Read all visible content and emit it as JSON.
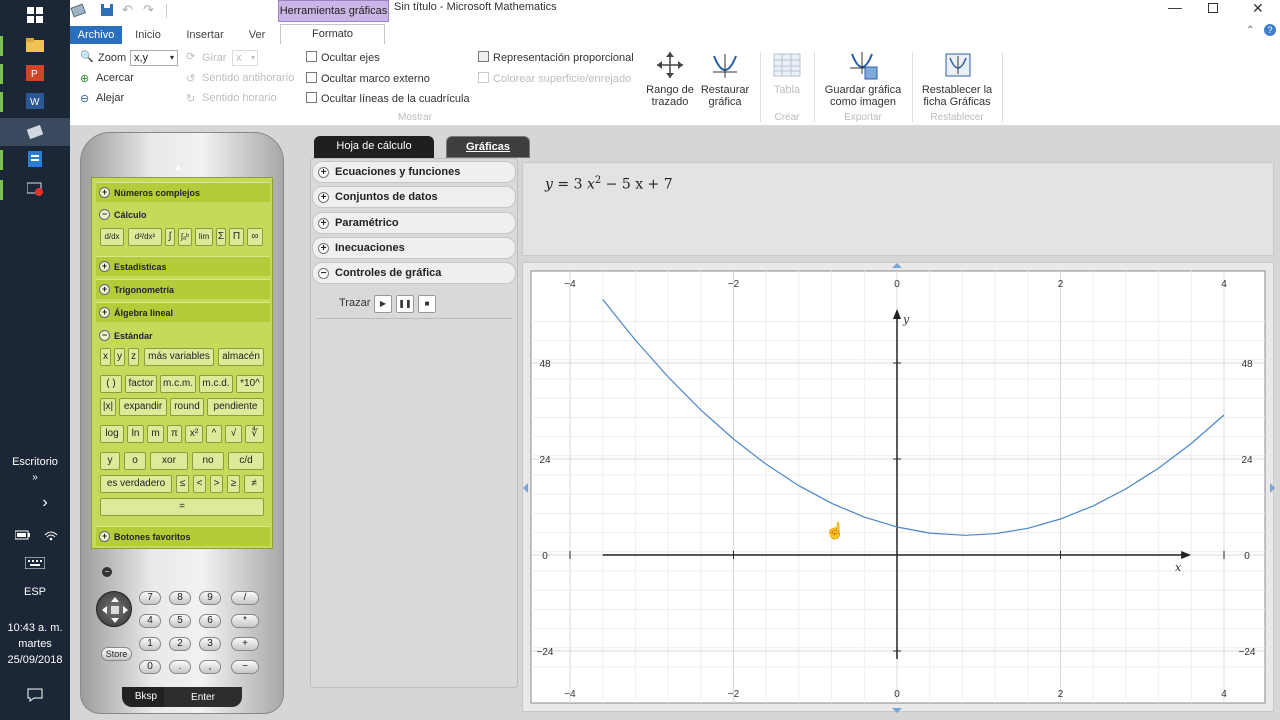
{
  "taskbar": {
    "desktop_label": "Escritorio",
    "language": "ESP",
    "time": "10:43 a. m.",
    "weekday": "martes",
    "date": "25/09/2018"
  },
  "titlebar": {
    "context_tab": "Herramientas gráficas",
    "title": "Sin título - Microsoft Mathematics"
  },
  "ribbon": {
    "tabs": [
      "Archivo",
      "Inicio",
      "Insertar",
      "Ver",
      "Formato"
    ],
    "zoom_label": "Zoom",
    "zoom_value": "x,y",
    "girar_label": "Girar",
    "girar_value": "x",
    "acercar": "Acercar",
    "alejar": "Alejar",
    "sentido_antihorario": "Sentido antihorario",
    "sentido_horario": "Sentido horario",
    "ocultar_ejes": "Ocultar ejes",
    "ocultar_marco": "Ocultar marco externo",
    "ocultar_lineas": "Ocultar líneas de la cuadrícula",
    "representacion": "Representación proporcional",
    "colorear": "Colorear superficie/enrejado",
    "group_mostrar": "Mostrar",
    "rango_line1": "Rango de",
    "rango_line2": "trazado",
    "restaurar_line1": "Restaurar",
    "restaurar_line2": "gráfica",
    "tabla": "Tabla",
    "group_crear": "Crear",
    "guardar_line1": "Guardar gráfica",
    "guardar_line2": "como imagen",
    "group_exportar": "Exportar",
    "restablecer_line1": "Restablecer la",
    "restablecer_line2": "ficha Gráficas",
    "group_restablecer": "Restablecer"
  },
  "calculator": {
    "sections": {
      "complejos": "Números complejos",
      "calculo": "Cálculo",
      "estadisticas": "Estadísticas",
      "trigonometria": "Trigonometría",
      "algebra": "Álgebra lineal",
      "estandar": "Estándar",
      "favoritos": "Botones favoritos"
    },
    "calc_keys": [
      "d/dx",
      "d²/dx²",
      "∫",
      "∫ₐᵇ",
      "lim",
      "Σ",
      "Π",
      "∞"
    ],
    "row1": [
      "x",
      "y",
      "z",
      "más variables",
      "almacén"
    ],
    "row2": [
      "( )",
      "factor",
      "m.c.m.",
      "m.c.d.",
      "*10^"
    ],
    "row3": [
      "|x|",
      "expandir",
      "round",
      "pendiente"
    ],
    "row4": [
      "log",
      "ln",
      "m",
      "π",
      "x²",
      "^",
      "√",
      "∜"
    ],
    "row5": [
      "y",
      "o",
      "xor",
      "no",
      "c/d"
    ],
    "row6": [
      "es verdadero",
      "≤",
      "<",
      ">",
      "≥",
      "≠"
    ],
    "equals": "=",
    "numpad": [
      [
        "7",
        "8",
        "9",
        "/"
      ],
      [
        "4",
        "5",
        "6",
        "*"
      ],
      [
        "1",
        "2",
        "3",
        "+"
      ],
      [
        "0",
        ".",
        ",",
        "−"
      ]
    ],
    "store": "Store",
    "bksp": "Bksp",
    "enter": "Enter"
  },
  "tabs": {
    "hoja": "Hoja de cálculo",
    "graficas": "Gráficas"
  },
  "accordion": {
    "ecuaciones": "Ecuaciones y funciones",
    "conjuntos": "Conjuntos de datos",
    "parametrico": "Paramétrico",
    "inecuaciones": "Inecuaciones",
    "controles": "Controles de gráfica",
    "trazar": "Trazar"
  },
  "equation": {
    "lhs": "y",
    "rhs_coef_a": "3",
    "rhs_var": "x",
    "rhs_exp": "2",
    "rhs_rest": "− 5 x + 7"
  },
  "chart_data": {
    "type": "line",
    "title": "",
    "xlabel": "x",
    "ylabel": "y",
    "xlim": [
      -4.1,
      4.1
    ],
    "ylim": [
      -30,
      62
    ],
    "x_ticks": [
      -4,
      -2,
      0,
      2,
      4
    ],
    "y_ticks": [
      -24,
      0,
      24,
      48
    ],
    "x_tick_labels": [
      "−4",
      "−2",
      "0",
      "2",
      "4"
    ],
    "y_tick_labels": [
      "−24",
      "0",
      "24",
      "48"
    ],
    "grid": true,
    "series": [
      {
        "function": "3x^2 - 5x + 7",
        "x": [
          -3.6,
          -3.2,
          -2.8,
          -2.4,
          -2.0,
          -1.6,
          -1.2,
          -0.8,
          -0.4,
          0.0,
          0.4,
          0.833,
          1.2,
          1.6,
          2.0,
          2.4,
          2.8,
          3.2,
          3.6,
          4.0
        ],
        "y": [
          63.88,
          53.72,
          44.52,
          36.28,
          29.0,
          22.68,
          17.32,
          12.92,
          9.48,
          7.0,
          5.48,
          4.92,
          5.32,
          6.68,
          9.0,
          12.28,
          16.52,
          21.72,
          27.88,
          35.0
        ],
        "color": "#4a86c8"
      }
    ]
  }
}
